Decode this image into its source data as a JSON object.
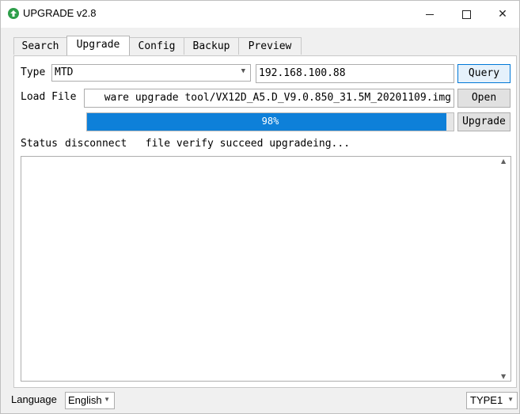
{
  "window": {
    "title": "UPGRADE v2.8",
    "minimize_glyph": "—",
    "maximize_glyph": "☐",
    "close_glyph": "✕"
  },
  "tabs": [
    {
      "label": "Search",
      "active": false
    },
    {
      "label": "Upgrade",
      "active": true
    },
    {
      "label": "Config",
      "active": false
    },
    {
      "label": "Backup",
      "active": false
    },
    {
      "label": "Preview",
      "active": false
    }
  ],
  "upgrade": {
    "type_label": "Type",
    "type_value": "MTD",
    "ip_value": "192.168.100.88",
    "query_label": "Query",
    "load_file_label": "Load File",
    "file_path": "ware upgrade tool/VX12D_A5.D_V9.0.850_31.5M_20201109.img",
    "open_label": "Open",
    "progress_percent": 98,
    "progress_text": "98%",
    "upgrade_label": "Upgrade",
    "status_label": "Status",
    "status_text": "disconnect   file verify succeed upgradeing..."
  },
  "footer": {
    "language_label": "Language",
    "language_value": "English",
    "type_value": "TYPE1"
  },
  "colors": {
    "progress_fill": "#0e80d9",
    "app_icon": "#2e9e4a",
    "focus_border": "#0078d7"
  },
  "icons": {
    "app": "upgrade-arrow-icon",
    "dropdown": "chevron-down-icon",
    "scroll_up": "scroll-up-arrow-icon",
    "scroll_down": "scroll-down-arrow-icon"
  }
}
